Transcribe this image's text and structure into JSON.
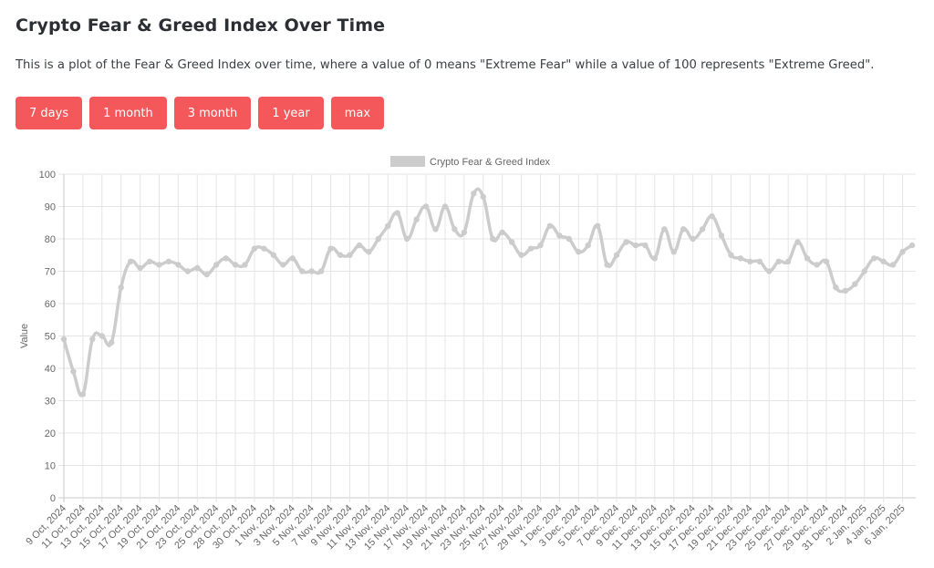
{
  "page": {
    "title": "Crypto Fear & Greed Index Over Time",
    "description": "This is a plot of the Fear & Greed Index over time, where a value of 0 means \"Extreme Fear\" while a value of 100 represents \"Extreme Greed\"."
  },
  "range_buttons": [
    {
      "label": "7 days"
    },
    {
      "label": "1 month"
    },
    {
      "label": "3 month"
    },
    {
      "label": "1 year"
    },
    {
      "label": "max"
    }
  ],
  "colors": {
    "button": "#f5585b",
    "series_line": "#cccccc",
    "grid": "#e5e5e5",
    "axis": "#c8c8c8",
    "tick_text": "#666666"
  },
  "chart_data": {
    "type": "line",
    "title": "",
    "xlabel": "",
    "ylabel": "Value",
    "ylim": [
      0,
      100
    ],
    "y_ticks": [
      0,
      10,
      20,
      30,
      40,
      50,
      60,
      70,
      80,
      90,
      100
    ],
    "grid": true,
    "legend_position": "top-center",
    "x": [
      "9 Oct, 2024",
      "10 Oct, 2024",
      "11 Oct, 2024",
      "12 Oct, 2024",
      "13 Oct, 2024",
      "14 Oct, 2024",
      "15 Oct, 2024",
      "16 Oct, 2024",
      "17 Oct, 2024",
      "18 Oct, 2024",
      "19 Oct, 2024",
      "20 Oct, 2024",
      "21 Oct, 2024",
      "22 Oct, 2024",
      "23 Oct, 2024",
      "24 Oct, 2024",
      "25 Oct, 2024",
      "26 Oct, 2024",
      "28 Oct, 2024",
      "29 Oct, 2024",
      "30 Oct, 2024",
      "31 Oct, 2024",
      "1 Nov, 2024",
      "2 Nov, 2024",
      "3 Nov, 2024",
      "4 Nov, 2024",
      "5 Nov, 2024",
      "6 Nov, 2024",
      "7 Nov, 2024",
      "8 Nov, 2024",
      "9 Nov, 2024",
      "10 Nov, 2024",
      "11 Nov, 2024",
      "12 Nov, 2024",
      "13 Nov, 2024",
      "14 Nov, 2024",
      "15 Nov, 2024",
      "16 Nov, 2024",
      "17 Nov, 2024",
      "18 Nov, 2024",
      "19 Nov, 2024",
      "20 Nov, 2024",
      "21 Nov, 2024",
      "22 Nov, 2024",
      "23 Nov, 2024",
      "24 Nov, 2024",
      "25 Nov, 2024",
      "26 Nov, 2024",
      "27 Nov, 2024",
      "28 Nov, 2024",
      "29 Nov, 2024",
      "30 Nov, 2024",
      "1 Dec, 2024",
      "2 Dec, 2024",
      "3 Dec, 2024",
      "4 Dec, 2024",
      "5 Dec, 2024",
      "6 Dec, 2024",
      "7 Dec, 2024",
      "8 Dec, 2024",
      "9 Dec, 2024",
      "10 Dec, 2024",
      "11 Dec, 2024",
      "12 Dec, 2024",
      "13 Dec, 2024",
      "14 Dec, 2024",
      "15 Dec, 2024",
      "16 Dec, 2024",
      "17 Dec, 2024",
      "18 Dec, 2024",
      "19 Dec, 2024",
      "20 Dec, 2024",
      "21 Dec, 2024",
      "22 Dec, 2024",
      "23 Dec, 2024",
      "24 Dec, 2024",
      "25 Dec, 2024",
      "26 Dec, 2024",
      "27 Dec, 2024",
      "28 Dec, 2024",
      "29 Dec, 2024",
      "30 Dec, 2024",
      "31 Dec, 2024",
      "1 Jan, 2025",
      "2 Jan, 2025",
      "3 Jan, 2025",
      "4 Jan, 2025",
      "5 Jan, 2025",
      "6 Jan, 2025",
      "7 Jan, 2025"
    ],
    "x_tick_labels_every": 2,
    "series": [
      {
        "name": "Crypto Fear & Greed Index",
        "values": [
          49,
          39,
          32,
          49,
          50,
          48,
          65,
          73,
          71,
          73,
          72,
          73,
          72,
          70,
          71,
          69,
          72,
          74,
          72,
          72,
          77,
          77,
          75,
          72,
          74,
          70,
          70,
          70,
          77,
          75,
          75,
          78,
          76,
          80,
          84,
          88,
          80,
          86,
          90,
          83,
          90,
          83,
          82,
          94,
          93,
          80,
          82,
          79,
          75,
          77,
          78,
          84,
          81,
          80,
          76,
          78,
          84,
          72,
          75,
          79,
          78,
          78,
          74,
          83,
          76,
          83,
          80,
          83,
          87,
          81,
          75,
          74,
          73,
          73,
          70,
          73,
          73,
          79,
          74,
          72,
          73,
          65,
          64,
          66,
          70,
          74,
          73,
          72,
          76,
          78
        ]
      }
    ]
  }
}
